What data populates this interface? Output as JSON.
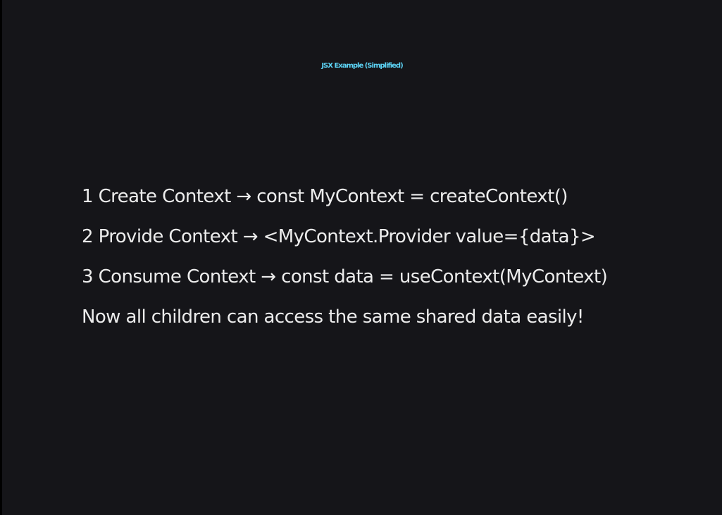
{
  "slide": {
    "title": "JSX Example (Simplified)",
    "lines": [
      "1 Create Context → const MyContext = createContext()",
      "2 Provide Context → <MyContext.Provider value={data}>",
      "3 Consume Context → const data = useContext(MyContext)",
      "Now all children can access the same shared data easily!"
    ]
  },
  "colors": {
    "background": "#151519",
    "title": "#5cd3f5",
    "text": "#ececec"
  }
}
